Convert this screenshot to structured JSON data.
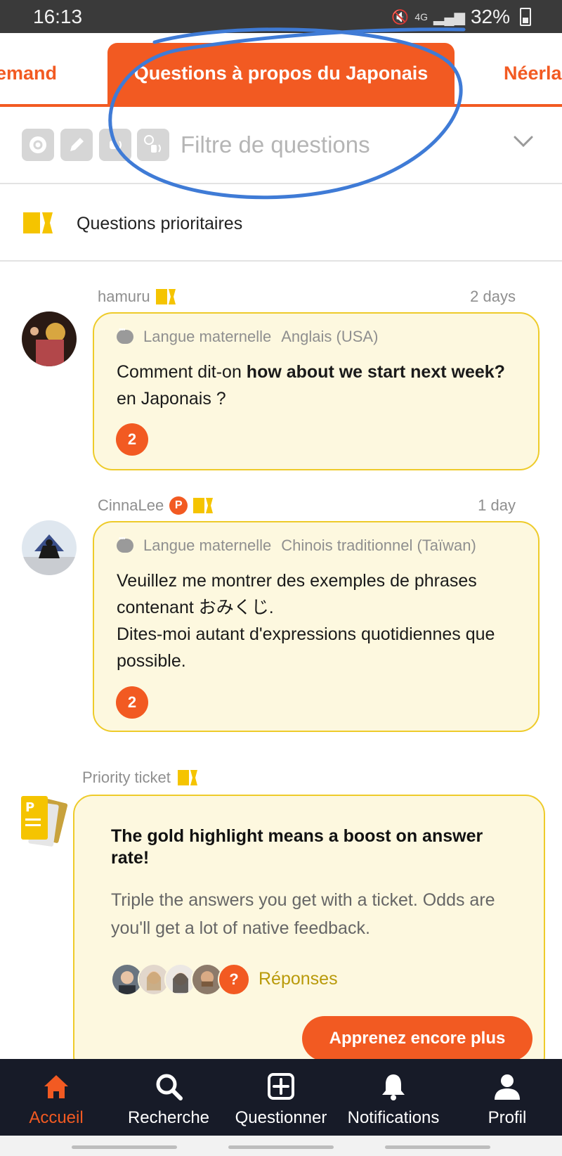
{
  "status_bar": {
    "time": "16:13",
    "network": "4G",
    "battery": "32%"
  },
  "tabs": [
    {
      "label": "emand",
      "active": false
    },
    {
      "label": "Questions à propos du Japonais",
      "active": true
    },
    {
      "label": "Néerla",
      "active": false
    }
  ],
  "filter": {
    "placeholder": "Filtre de questions",
    "icons": [
      "question-type-icon",
      "pencil-icon",
      "audio-icon",
      "translate-audio-icon"
    ]
  },
  "priority": {
    "label": "Questions prioritaires"
  },
  "posts": [
    {
      "user": "hamuru",
      "time": "2 days",
      "lang_label": "Langue maternelle",
      "lang_value": "Anglais (USA)",
      "text_pre": "Comment dit-on ",
      "text_bold": "how about we start next week?",
      "text_post": " en Japonais ?",
      "answers": "2"
    },
    {
      "user": "CinnaLee",
      "premium": "P",
      "time": "1 day",
      "lang_label": "Langue maternelle",
      "lang_value": "Chinois traditionnel (Taïwan)",
      "text_pre": "Veuillez me montrer des exemples de phrases contenant ",
      "text_bold": "おみくじ",
      "text_post": ".",
      "text_line2": "Dites-moi autant d'expressions quotidiennes que possible.",
      "answers": "2"
    }
  ],
  "promo": {
    "meta": "Priority ticket",
    "title": "The gold highlight means a boost on answer rate!",
    "description": "Triple the answers you get with a ticket. Odds are you'll get a lot of native feedback.",
    "question_mark": "?",
    "answers_label": "Réponses",
    "button": "Apprenez encore plus"
  },
  "nav": [
    {
      "label": "Accueil",
      "icon": "home-icon",
      "active": true
    },
    {
      "label": "Recherche",
      "icon": "search-icon",
      "active": false
    },
    {
      "label": "Questionner",
      "icon": "add-question-icon",
      "active": false
    },
    {
      "label": "Notifications",
      "icon": "bell-icon",
      "active": false
    },
    {
      "label": "Profil",
      "icon": "profile-icon",
      "active": false
    }
  ],
  "colors": {
    "accent": "#f25a22",
    "highlight": "#fdf8df",
    "gold": "#f5c400",
    "nav_bg": "#171b28"
  }
}
